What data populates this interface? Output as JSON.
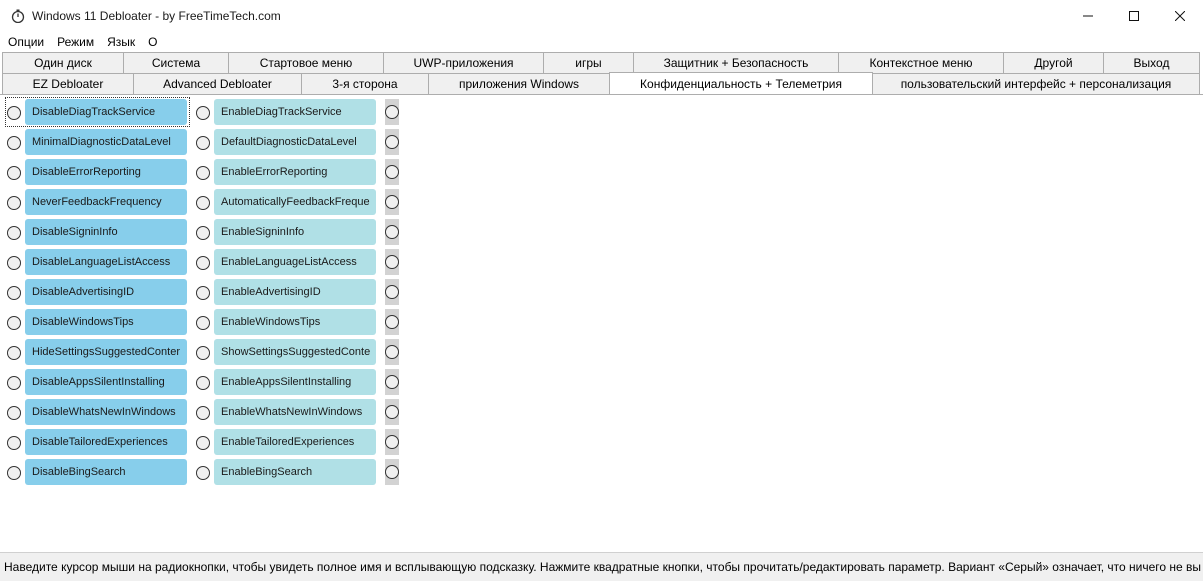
{
  "window": {
    "title": "Windows 11 Debloater - by FreeTimeTech.com",
    "icon": "stopwatch-icon"
  },
  "menu": [
    "Опции",
    "Режим",
    "Язык",
    "О"
  ],
  "tabs_row1": [
    "Один диск",
    "Система",
    "Стартовое меню",
    "UWP-приложения",
    "игры",
    "Защитник + Безопасность",
    "Контекстное меню",
    "Другой",
    "Выход"
  ],
  "tabs_row2": [
    "EZ Debloater",
    "Advanced Debloater",
    "3-я сторона",
    "приложения Windows",
    "Конфиденциальность + Телеметрия",
    "пользовательский интерфейс + персонализация"
  ],
  "selected_tab": "Конфиденциальность + Телеметрия",
  "options": [
    {
      "disable": "DisableDiagTrackService",
      "enable": "EnableDiagTrackService"
    },
    {
      "disable": "MinimalDiagnosticDataLevel",
      "enable": "DefaultDiagnosticDataLevel"
    },
    {
      "disable": "DisableErrorReporting",
      "enable": "EnableErrorReporting"
    },
    {
      "disable": "NeverFeedbackFrequency",
      "enable": "AutomaticallyFeedbackFreque"
    },
    {
      "disable": "DisableSigninInfo",
      "enable": "EnableSigninInfo"
    },
    {
      "disable": "DisableLanguageListAccess",
      "enable": "EnableLanguageListAccess"
    },
    {
      "disable": "DisableAdvertisingID",
      "enable": "EnableAdvertisingID"
    },
    {
      "disable": "DisableWindowsTips",
      "enable": "EnableWindowsTips"
    },
    {
      "disable": "HideSettingsSuggestedConter",
      "enable": "ShowSettingsSuggestedConte"
    },
    {
      "disable": "DisableAppsSilentInstalling",
      "enable": "EnableAppsSilentInstalling"
    },
    {
      "disable": "DisableWhatsNewInWindows",
      "enable": "EnableWhatsNewInWindows"
    },
    {
      "disable": "DisableTailoredExperiences",
      "enable": "EnableTailoredExperiences"
    },
    {
      "disable": "DisableBingSearch",
      "enable": "EnableBingSearch"
    }
  ],
  "status": "Наведите курсор мыши на радиокнопки, чтобы увидеть полное имя и всплывающую подсказку. Нажмите квадратные кнопки, чтобы прочитать/редактировать параметр. Вариант «Серый» означает, что ничего не вы",
  "colors": {
    "disable_button": "#87ceeb",
    "enable_button": "#b0e0e6",
    "gray_option": "#d3d3d3",
    "tab_background": "#f0f0f0"
  }
}
